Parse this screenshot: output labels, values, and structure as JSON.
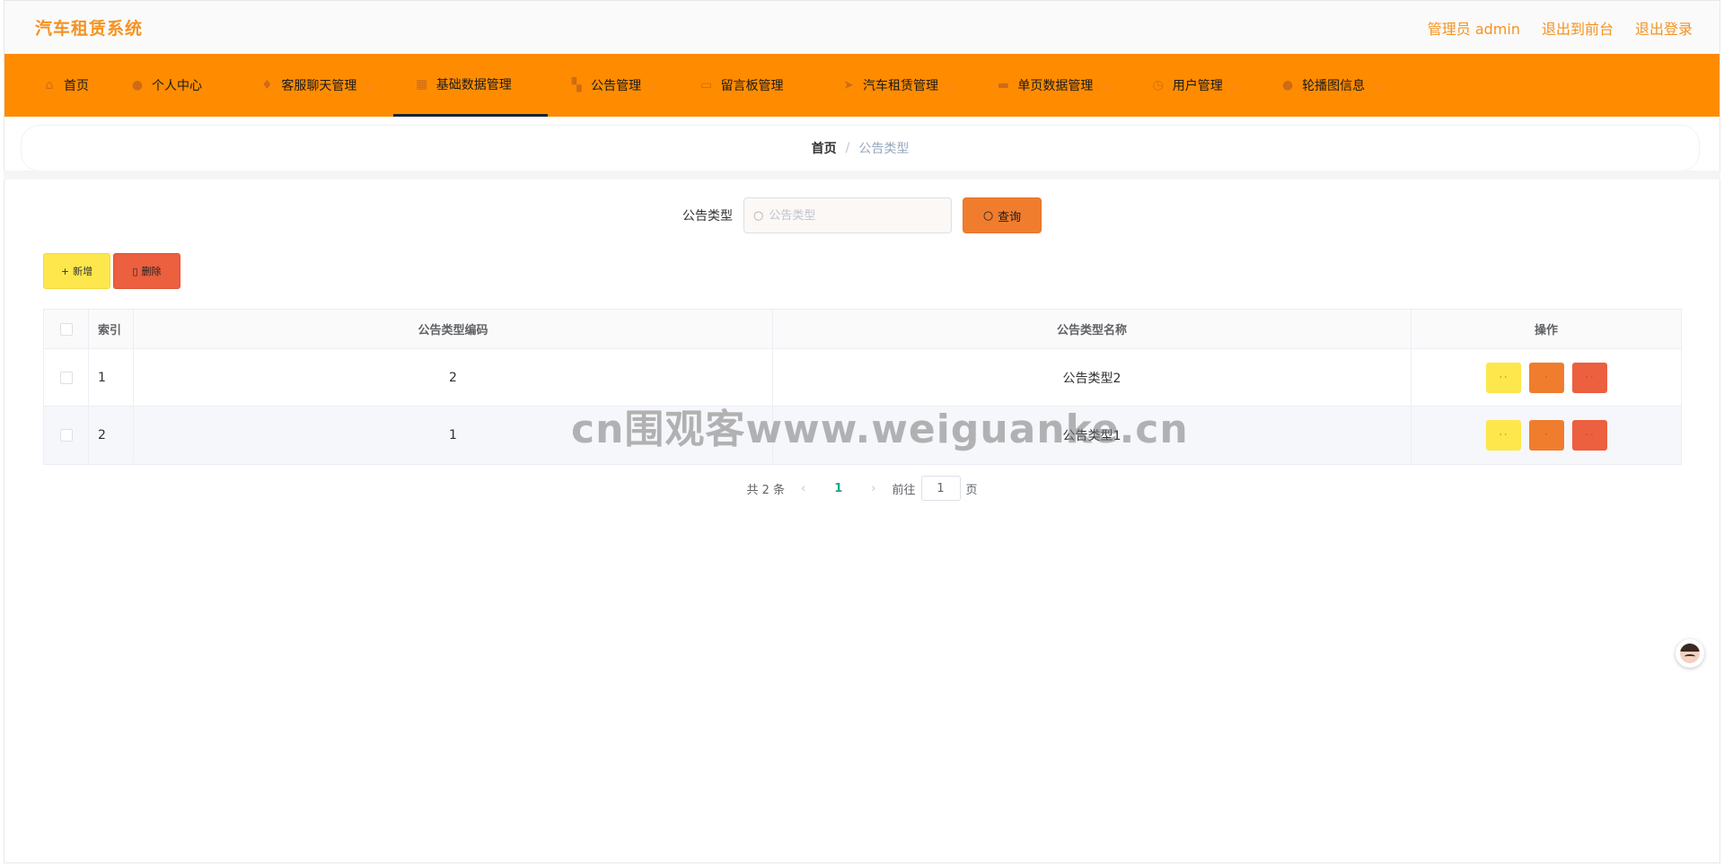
{
  "app": {
    "title": "汽车租赁系统",
    "user_label": "管理员 admin",
    "exit_front": "退出到前台",
    "logout": "退出登录"
  },
  "nav": {
    "items": [
      {
        "label": "首页",
        "icon": "home-icon"
      },
      {
        "label": "个人中心",
        "icon": "user-icon"
      },
      {
        "label": "客服聊天管理",
        "icon": "chat-icon"
      },
      {
        "label": "基础数据管理",
        "icon": "grid-icon"
      },
      {
        "label": "公告管理",
        "icon": "apps-icon"
      },
      {
        "label": "留言板管理",
        "icon": "message-icon"
      },
      {
        "label": "汽车租赁管理",
        "icon": "navigation-icon"
      },
      {
        "label": "单页数据管理",
        "icon": "ticket-icon"
      },
      {
        "label": "用户管理",
        "icon": "clock-icon"
      },
      {
        "label": "轮播图信息",
        "icon": "person-icon"
      }
    ],
    "active_index": 3
  },
  "breadcrumb": {
    "home": "首页",
    "separator": "/",
    "current": "公告类型"
  },
  "search": {
    "label": "公告类型",
    "placeholder": "公告类型",
    "value": "",
    "button": "查询"
  },
  "actions": {
    "add": "新增",
    "delete": "删除"
  },
  "table": {
    "headers": {
      "index": "索引",
      "code": "公告类型编码",
      "name": "公告类型名称",
      "ops": "操作"
    },
    "rows": [
      {
        "index": "1",
        "code": "2",
        "name": "公告类型2",
        "view": "· ·",
        "edit": "·",
        "del": "· ·"
      },
      {
        "index": "2",
        "code": "1",
        "name": "公告类型1",
        "view": "· ·",
        "edit": "·",
        "del": "· ·"
      }
    ]
  },
  "pager": {
    "total": "共 2 条",
    "current": "1",
    "goto_label": "前往",
    "goto_value": "1",
    "page_suffix": "页"
  },
  "watermark": "cn围观客www.weiguanke.cn",
  "colors": {
    "brand": "#f59220",
    "nav_bg": "#ff8c00",
    "btn_yellow": "#fde74c",
    "btn_orange": "#f07d2e",
    "btn_red": "#ec5f3f",
    "pager_active": "#1ba784"
  }
}
